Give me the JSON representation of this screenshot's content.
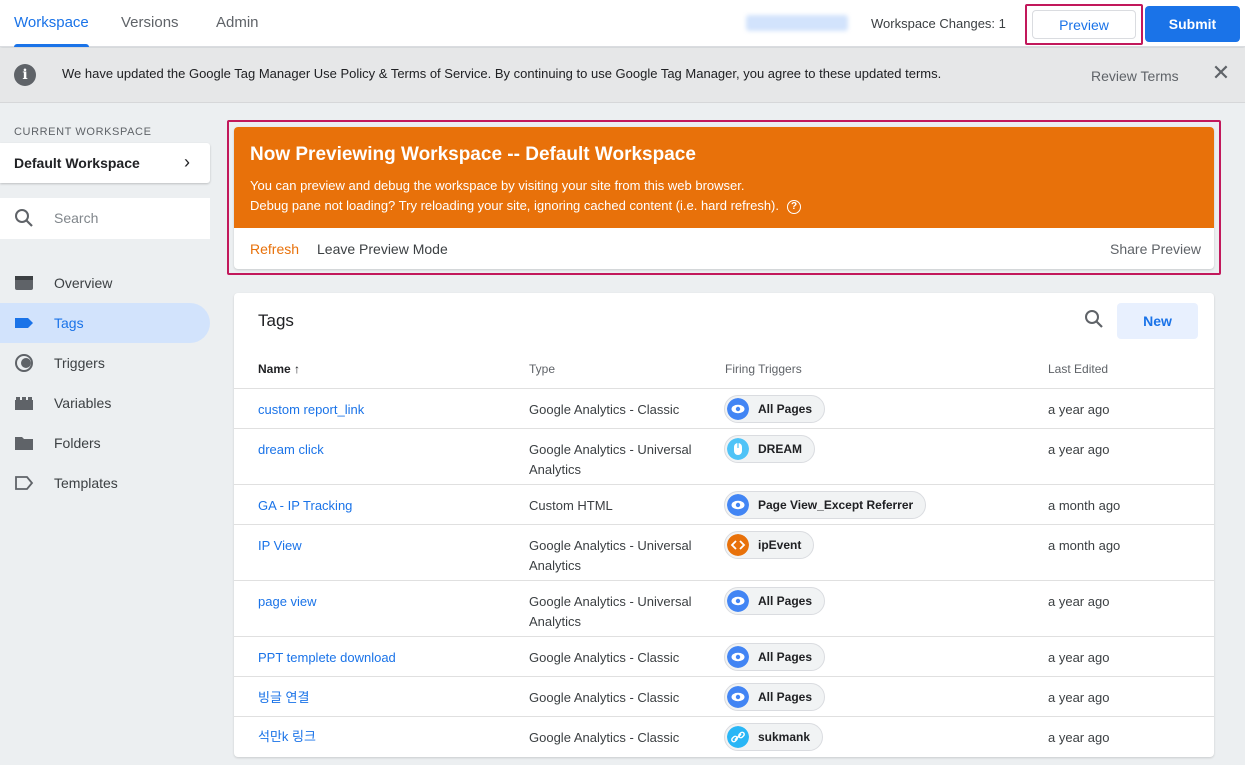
{
  "topbar": {
    "tabs": [
      "Workspace",
      "Versions",
      "Admin"
    ],
    "workspace_changes": "Workspace Changes: 1",
    "preview_label": "Preview",
    "submit_label": "Submit"
  },
  "notice": {
    "text": "We have updated the Google Tag Manager Use Policy & Terms of Service. By continuing to use Google Tag Manager, you agree to these updated terms.",
    "review_label": "Review Terms"
  },
  "sidebar": {
    "current_workspace_label": "CURRENT WORKSPACE",
    "workspace_name": "Default Workspace",
    "search_placeholder": "Search",
    "items": [
      {
        "label": "Overview",
        "icon": "overview-icon"
      },
      {
        "label": "Tags",
        "icon": "tag-icon",
        "active": true
      },
      {
        "label": "Triggers",
        "icon": "trigger-icon"
      },
      {
        "label": "Variables",
        "icon": "variables-icon"
      },
      {
        "label": "Folders",
        "icon": "folder-icon"
      },
      {
        "label": "Templates",
        "icon": "template-icon"
      }
    ]
  },
  "preview_panel": {
    "title": "Now Previewing Workspace -- Default Workspace",
    "line1": "You can preview and debug the workspace by visiting your site from this web browser.",
    "line2": "Debug pane not loading? Try reloading your site, ignoring cached content (i.e. hard refresh).",
    "refresh": "Refresh",
    "leave": "Leave Preview Mode",
    "share": "Share Preview",
    "accent": "#e8710a"
  },
  "tags": {
    "title": "Tags",
    "new_label": "New",
    "columns": {
      "name": "Name",
      "type": "Type",
      "triggers": "Firing Triggers",
      "edited": "Last Edited"
    },
    "sort_indicator": "↑",
    "rows": [
      {
        "name": "custom report_link",
        "type": "Google Analytics - Classic",
        "trigger": "All Pages",
        "trigger_icon": "pageview-icon",
        "edited": "a year ago"
      },
      {
        "name": "dream click",
        "type": "Google Analytics - Universal Analytics",
        "trigger": "DREAM",
        "trigger_icon": "click-icon",
        "edited": "a year ago"
      },
      {
        "name": "GA - IP Tracking",
        "type": "Custom HTML",
        "trigger": "Page View_Except Referrer",
        "trigger_icon": "pageview-icon",
        "edited": "a month ago"
      },
      {
        "name": "IP View",
        "type": "Google Analytics - Universal Analytics",
        "trigger": "ipEvent",
        "trigger_icon": "custom-event-icon",
        "edited": "a month ago"
      },
      {
        "name": "page view",
        "type": "Google Analytics - Universal Analytics",
        "trigger": "All Pages",
        "trigger_icon": "pageview-icon",
        "edited": "a year ago"
      },
      {
        "name": "PPT templete download",
        "type": "Google Analytics - Classic",
        "trigger": "All Pages",
        "trigger_icon": "pageview-icon",
        "edited": "a year ago"
      },
      {
        "name": "빙글 연결",
        "type": "Google Analytics - Classic",
        "trigger": "All Pages",
        "trigger_icon": "pageview-icon",
        "edited": "a year ago"
      },
      {
        "name": "석만k 링크",
        "type": "Google Analytics - Classic",
        "trigger": "sukmank",
        "trigger_icon": "link-click-icon",
        "edited": "a year ago"
      }
    ]
  }
}
